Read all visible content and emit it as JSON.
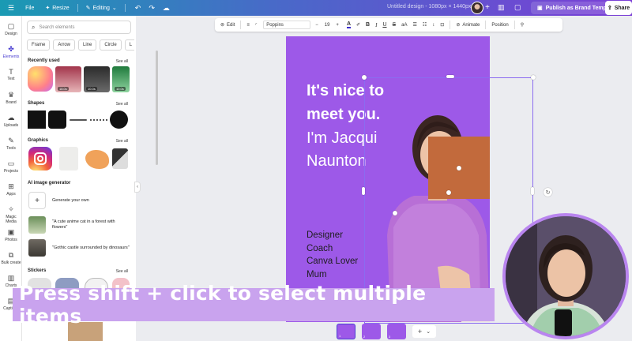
{
  "topbar": {
    "file": "File",
    "resize": "Resize",
    "editing": "Editing",
    "doc_title": "Untitled design - 1080px × 1440px",
    "publish": "Publish as Brand Template",
    "share": "Share"
  },
  "rail": [
    {
      "label": "Design",
      "icon": "design-icon",
      "glyph": "▢"
    },
    {
      "label": "Elements",
      "icon": "elements-icon",
      "glyph": "✤"
    },
    {
      "label": "Text",
      "icon": "text-icon",
      "glyph": "T"
    },
    {
      "label": "Brand",
      "icon": "brand-icon",
      "glyph": "♛"
    },
    {
      "label": "Uploads",
      "icon": "upload-icon",
      "glyph": "☁"
    },
    {
      "label": "Tools",
      "icon": "tools-icon",
      "glyph": "✎"
    },
    {
      "label": "Projects",
      "icon": "folder-icon",
      "glyph": "▭"
    },
    {
      "label": "Apps",
      "icon": "apps-icon",
      "glyph": "⊞"
    },
    {
      "label": "Magic Media",
      "icon": "magic-media-icon",
      "glyph": "✧"
    },
    {
      "label": "Photos",
      "icon": "photos-icon",
      "glyph": "▣"
    },
    {
      "label": "Bulk create",
      "icon": "bulk-create-icon",
      "glyph": "⧉"
    },
    {
      "label": "Charts",
      "icon": "charts-icon",
      "glyph": "▥"
    },
    {
      "label": "Captions",
      "icon": "captions-icon",
      "glyph": "▤"
    }
  ],
  "panel": {
    "search_placeholder": "Search elements",
    "chips": [
      "Frame",
      "Arrow",
      "Line",
      "Circle",
      "L"
    ],
    "recently_used": "Recently used",
    "shapes": "Shapes",
    "graphics": "Graphics",
    "ai_generator": "AI image generator",
    "generate_own": "Generate your own",
    "prompt1": "\"A cute anime cat in a forest with flowers\"",
    "prompt2": "\"Gothic castle surrounded by dinosaurs\"",
    "stickers": "Stickers",
    "see_all": "See all",
    "durations": [
      "18.0s",
      "10.0s",
      "10.0s"
    ]
  },
  "toolbar": {
    "edit": "Edit",
    "font": "Poppins",
    "size": "19",
    "animate": "Animate",
    "position": "Position"
  },
  "canvas": {
    "headline1": "It's nice to",
    "headline2": "meet you.",
    "sub1": "I'm Jacqui",
    "sub2": "Naunton",
    "roles": [
      "Designer",
      "Coach",
      "Canva Lover",
      "Mum"
    ]
  },
  "pages": [
    "1",
    "2",
    "3"
  ],
  "caption": "Press shift + click to select multiple items"
}
